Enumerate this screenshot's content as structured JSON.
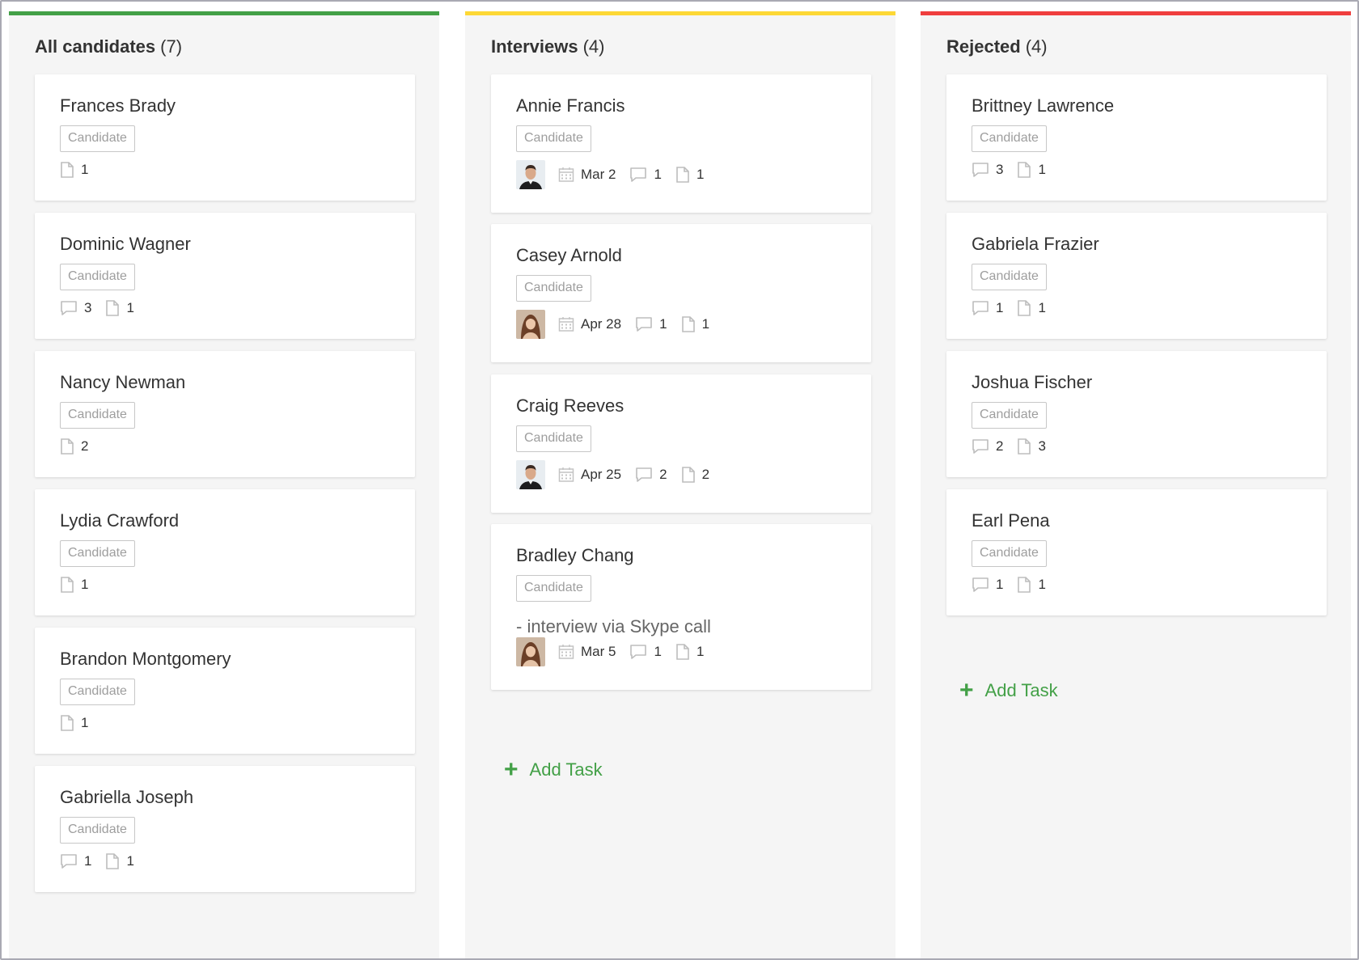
{
  "colors": {
    "green": "#43a047",
    "yellow": "#fdd835",
    "red": "#ef3e3e"
  },
  "columns": [
    {
      "title": "All candidates",
      "count": "(7)",
      "cards": [
        {
          "name": "Frances Brady",
          "tag": "Candidate",
          "files": "1"
        },
        {
          "name": "Dominic Wagner",
          "tag": "Candidate",
          "comments": "3",
          "files": "1"
        },
        {
          "name": "Nancy Newman",
          "tag": "Candidate",
          "files": "2"
        },
        {
          "name": "Lydia Crawford",
          "tag": "Candidate",
          "files": "1"
        },
        {
          "name": "Brandon Montgomery",
          "tag": "Candidate",
          "files": "1"
        },
        {
          "name": "Gabriella Joseph",
          "tag": "Candidate",
          "comments": "1",
          "files": "1"
        }
      ]
    },
    {
      "title": "Interviews",
      "count": "(4)",
      "cards": [
        {
          "name": "Annie Francis",
          "tag": "Candidate",
          "avatar": "male-avatar",
          "date": "Mar 2",
          "comments": "1",
          "files": "1"
        },
        {
          "name": "Casey Arnold",
          "tag": "Candidate",
          "avatar": "female-avatar",
          "date": "Apr 28",
          "comments": "1",
          "files": "1"
        },
        {
          "name": "Craig Reeves",
          "tag": "Candidate",
          "avatar": "male-avatar",
          "date": "Apr 25",
          "comments": "2",
          "files": "2"
        },
        {
          "name": "Bradley Chang",
          "tag": "Candidate",
          "note": "- interview via Skype call",
          "avatar": "female-avatar",
          "date": "Mar 5",
          "comments": "1",
          "files": "1"
        }
      ],
      "add_task": "Add Task"
    },
    {
      "title": "Rejected",
      "count": "(4)",
      "cards": [
        {
          "name": "Brittney Lawrence",
          "tag": "Candidate",
          "comments": "3",
          "files": "1"
        },
        {
          "name": "Gabriela Frazier",
          "tag": "Candidate",
          "comments": "1",
          "files": "1"
        },
        {
          "name": "Joshua Fischer",
          "tag": "Candidate",
          "comments": "2",
          "files": "3"
        },
        {
          "name": "Earl Pena",
          "tag": "Candidate",
          "comments": "1",
          "files": "1"
        }
      ],
      "add_task": "Add Task"
    }
  ]
}
